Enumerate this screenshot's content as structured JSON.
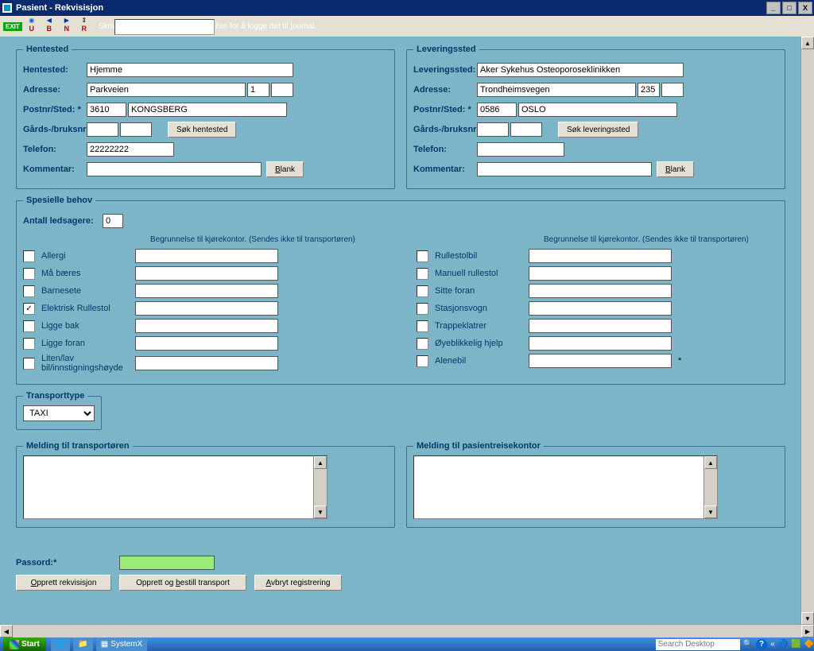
{
  "window": {
    "title": "Pasient - Rekvisisjon"
  },
  "toolbar": {
    "exit": "EXIT",
    "hint": "Skriv/lim inn rekvisisjonsnummer her for å logge det til journal.",
    "nav": {
      "u": "U",
      "b": "B",
      "n": "N",
      "r": "R"
    }
  },
  "pickup": {
    "legend": "Hentested",
    "place_label": "Hentested:",
    "place": "Hjemme",
    "addr_label": "Adresse:",
    "addr_street": "Parkveien",
    "addr_no": "1",
    "addr_extra": "",
    "post_label": "Postnr/Sted: *",
    "post_code": "3610",
    "post_city": "KONGSBERG",
    "gbr_label": "Gårds-/bruksnr:",
    "gbr1": "",
    "gbr2": "",
    "search_btn": "Søk hentested",
    "tel_label": "Telefon:",
    "tel": "22222222",
    "comment_label": "Kommentar:",
    "comment": "",
    "blank_btn": "Blank"
  },
  "delivery": {
    "legend": "Leveringssted",
    "place_label": "Leveringssted:",
    "place": "Aker Sykehus Osteoporoseklinikken",
    "addr_label": "Adresse:",
    "addr_street": "Trondheimsvegen",
    "addr_no": "235",
    "addr_extra": "",
    "post_label": "Postnr/Sted: *",
    "post_code": "0586",
    "post_city": "OSLO",
    "gbr_label": "Gårds-/bruksnr:",
    "gbr1": "",
    "gbr2": "",
    "search_btn": "Søk leveringssted",
    "tel_label": "Telefon:",
    "tel": "",
    "comment_label": "Kommentar:",
    "comment": "",
    "blank_btn": "Blank"
  },
  "special": {
    "legend": "Spesielle behov",
    "count_label": "Antall ledsagere:",
    "count": "0",
    "note": "Begrunnelse til kjørekontor. (Sendes ikke til transportøren)",
    "left": [
      {
        "label": "Allergi"
      },
      {
        "label": "Må bæres"
      },
      {
        "label": "Barnesete"
      },
      {
        "label": "Elektrisk Rullestol",
        "checked": true
      },
      {
        "label": "Ligge bak"
      },
      {
        "label": "Ligge foran"
      },
      {
        "label": "Liten/lav bil/innstigningshøyde"
      }
    ],
    "right": [
      {
        "label": "Rullestolbil"
      },
      {
        "label": "Manuell rullestol"
      },
      {
        "label": "Sitte foran"
      },
      {
        "label": "Stasjonsvogn"
      },
      {
        "label": "Trappeklatrer"
      },
      {
        "label": "Øyeblikkelig hjelp"
      },
      {
        "label": "Alenebil",
        "star": true
      }
    ]
  },
  "transport": {
    "legend": "Transporttype",
    "value": "TAXI"
  },
  "msg_transport": {
    "legend": "Melding til transportøren",
    "value": ""
  },
  "msg_office": {
    "legend": "Melding til pasientreisekontor",
    "value": ""
  },
  "footer": {
    "pwd_label": "Passord:*",
    "pwd": "",
    "btn_create": "Opprett rekvisisjon",
    "btn_order": "Opprett og bestill transport",
    "btn_cancel": "Avbryt registrering"
  },
  "taskbar": {
    "start": "Start",
    "app": "SystemX",
    "search_placeholder": "Search Desktop"
  }
}
